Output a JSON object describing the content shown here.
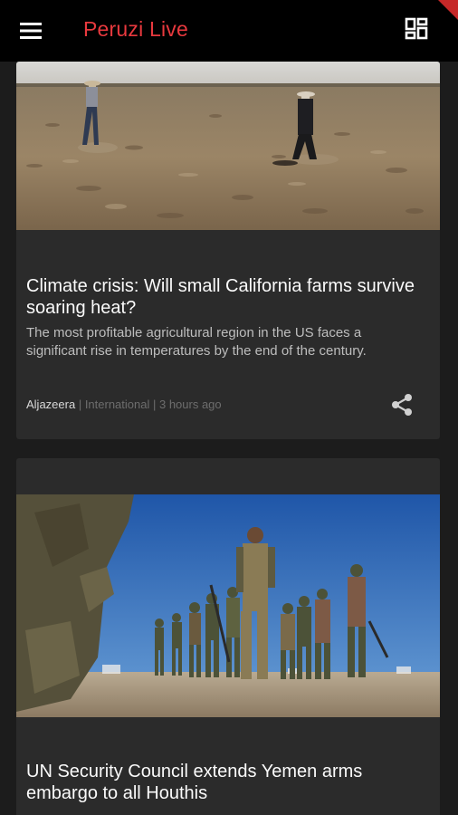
{
  "app": {
    "title": "Peruzi Live"
  },
  "icons": {
    "menu": "hamburger-menu-icon",
    "layout": "grid-layout-icon",
    "share": "share-icon"
  },
  "colors": {
    "brand": "#e8393e",
    "appbar": "#000000",
    "card": "#2b2b2b",
    "background": "#1c1c1c"
  },
  "articles": [
    {
      "headline": "Climate crisis: Will small California farms survive soaring heat?",
      "summary": "The most profitable agricultural region in the US faces a significant rise in temperatures by the end of the century.",
      "source": "Aljazeera",
      "separator": " | ",
      "category": "International",
      "time": "3 hours ago"
    },
    {
      "headline": "UN Security Council extends Yemen arms embargo to all Houthis"
    }
  ]
}
